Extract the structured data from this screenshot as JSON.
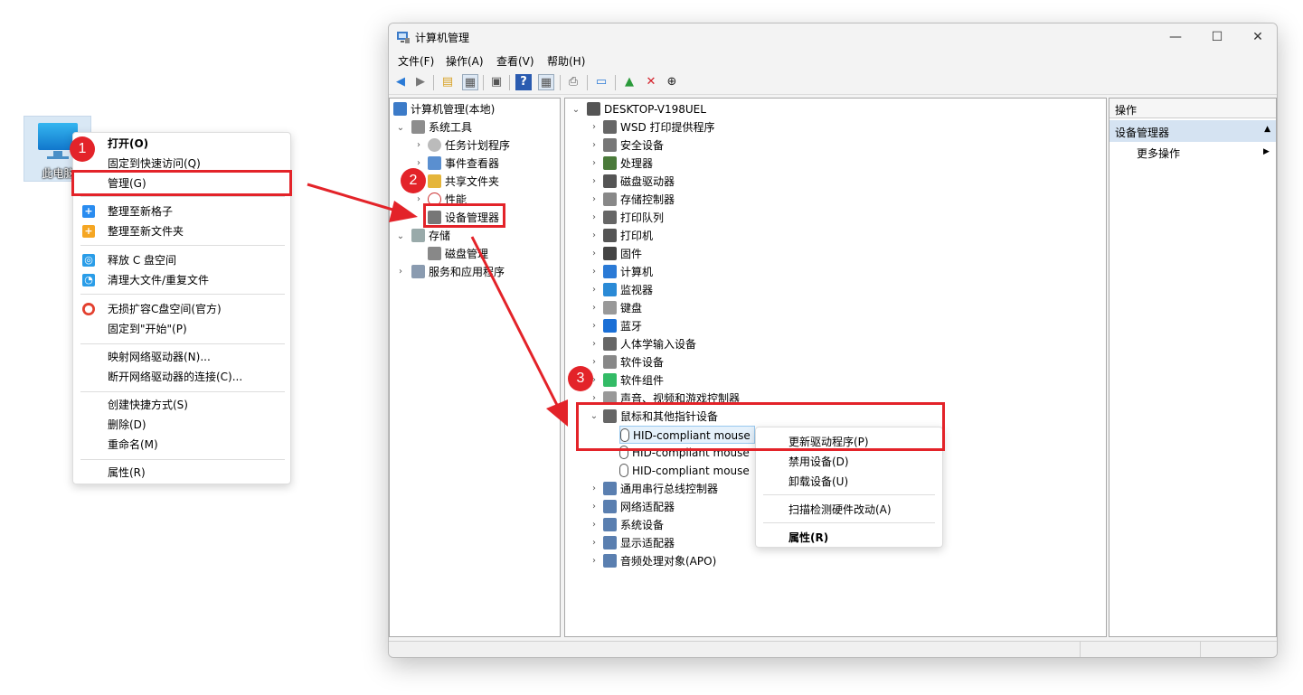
{
  "desktop": {
    "icon_label": "此电脑"
  },
  "context_menu": {
    "items": [
      {
        "label": "打开(O)"
      },
      {
        "label": "固定到快速访问(Q)"
      },
      {
        "label": "管理(G)"
      },
      {
        "label": "整理至新格子"
      },
      {
        "label": "整理至新文件夹"
      },
      {
        "label": "释放 C 盘空间"
      },
      {
        "label": "清理大文件/重复文件"
      },
      {
        "label": "无损扩容C盘空间(官方)"
      },
      {
        "label": "固定到\"开始\"(P)"
      },
      {
        "label": "映射网络驱动器(N)..."
      },
      {
        "label": "断开网络驱动器的连接(C)..."
      },
      {
        "label": "创建快捷方式(S)"
      },
      {
        "label": "删除(D)"
      },
      {
        "label": "重命名(M)"
      },
      {
        "label": "属性(R)"
      }
    ]
  },
  "badges": [
    "1",
    "2",
    "3"
  ],
  "window": {
    "title": "计算机管理",
    "controls": {
      "minimize": "—",
      "maximize": "☐",
      "close": "✕"
    },
    "menu": [
      "文件(F)",
      "操作(A)",
      "查看(V)",
      "帮助(H)"
    ],
    "left_tree": [
      {
        "label": "计算机管理(本地)"
      },
      {
        "label": "系统工具"
      },
      {
        "label": "任务计划程序"
      },
      {
        "label": "事件查看器"
      },
      {
        "label": "共享文件夹"
      },
      {
        "label": "性能"
      },
      {
        "label": "设备管理器"
      },
      {
        "label": "存储"
      },
      {
        "label": "磁盘管理"
      },
      {
        "label": "服务和应用程序"
      }
    ],
    "device_tree": {
      "root": "DESKTOP-V198UEL",
      "categories": [
        "WSD 打印提供程序",
        "安全设备",
        "处理器",
        "磁盘驱动器",
        "存储控制器",
        "打印队列",
        "打印机",
        "固件",
        "计算机",
        "监视器",
        "键盘",
        "蓝牙",
        "人体学输入设备",
        "软件设备",
        "软件组件",
        "声音、视频和游戏控制器",
        "鼠标和其他指针设备"
      ],
      "mouse_children": [
        "HID-compliant mouse",
        "HID-compliant mouse",
        "HID-compliant mouse"
      ],
      "categories_after": [
        "通用串行总线控制器",
        "网络适配器",
        "系统设备",
        "显示适配器",
        "音频处理对象(APO)"
      ]
    },
    "actions": {
      "header": "操作",
      "section": "设备管理器",
      "more": "更多操作"
    }
  },
  "submenu": {
    "items": [
      "更新驱动程序(P)",
      "禁用设备(D)",
      "卸载设备(U)",
      "扫描检测硬件改动(A)",
      "属性(R)"
    ]
  }
}
